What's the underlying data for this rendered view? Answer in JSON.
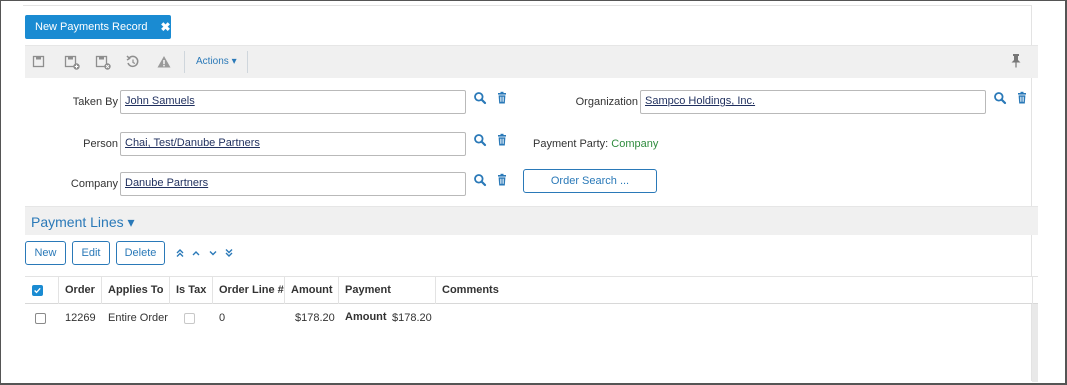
{
  "tab": {
    "title": "New Payments Record",
    "close_icon": "close-icon"
  },
  "toolbar": {
    "icons": [
      "save-icon",
      "save-new-icon",
      "save-close-icon",
      "undo-icon",
      "warning-icon"
    ],
    "actions_label": "Actions ▾",
    "pin_icon": "pin-icon"
  },
  "form": {
    "taken_by": {
      "label": "Taken By",
      "value": "John Samuels"
    },
    "organization": {
      "label": "Organization",
      "value": "Sampco Holdings, Inc."
    },
    "person": {
      "label": "Person",
      "value": "Chai, Test/Danube Partners"
    },
    "payment_party": {
      "label": "Payment Party:",
      "value": "Company"
    },
    "company": {
      "label": "Company",
      "value": "Danube Partners"
    },
    "order_search_label": "Order Search ..."
  },
  "payment_lines": {
    "title": "Payment Lines ▾",
    "buttons": {
      "new": "New",
      "edit": "Edit",
      "delete": "Delete"
    },
    "columns": [
      "Order",
      "Applies To",
      "Is Tax",
      "Order Line #",
      "Amount",
      "Payment Amount",
      "Comments"
    ],
    "rows": [
      {
        "order": "12269",
        "applies_to": "Entire Order",
        "is_tax": false,
        "order_line": "0",
        "amount": "$178.20",
        "payment_amount": "$178.20",
        "comments": ""
      }
    ]
  },
  "colors": {
    "accent": "#1a8bd2",
    "link": "#2a79b8",
    "positive": "#2f8c3e"
  }
}
